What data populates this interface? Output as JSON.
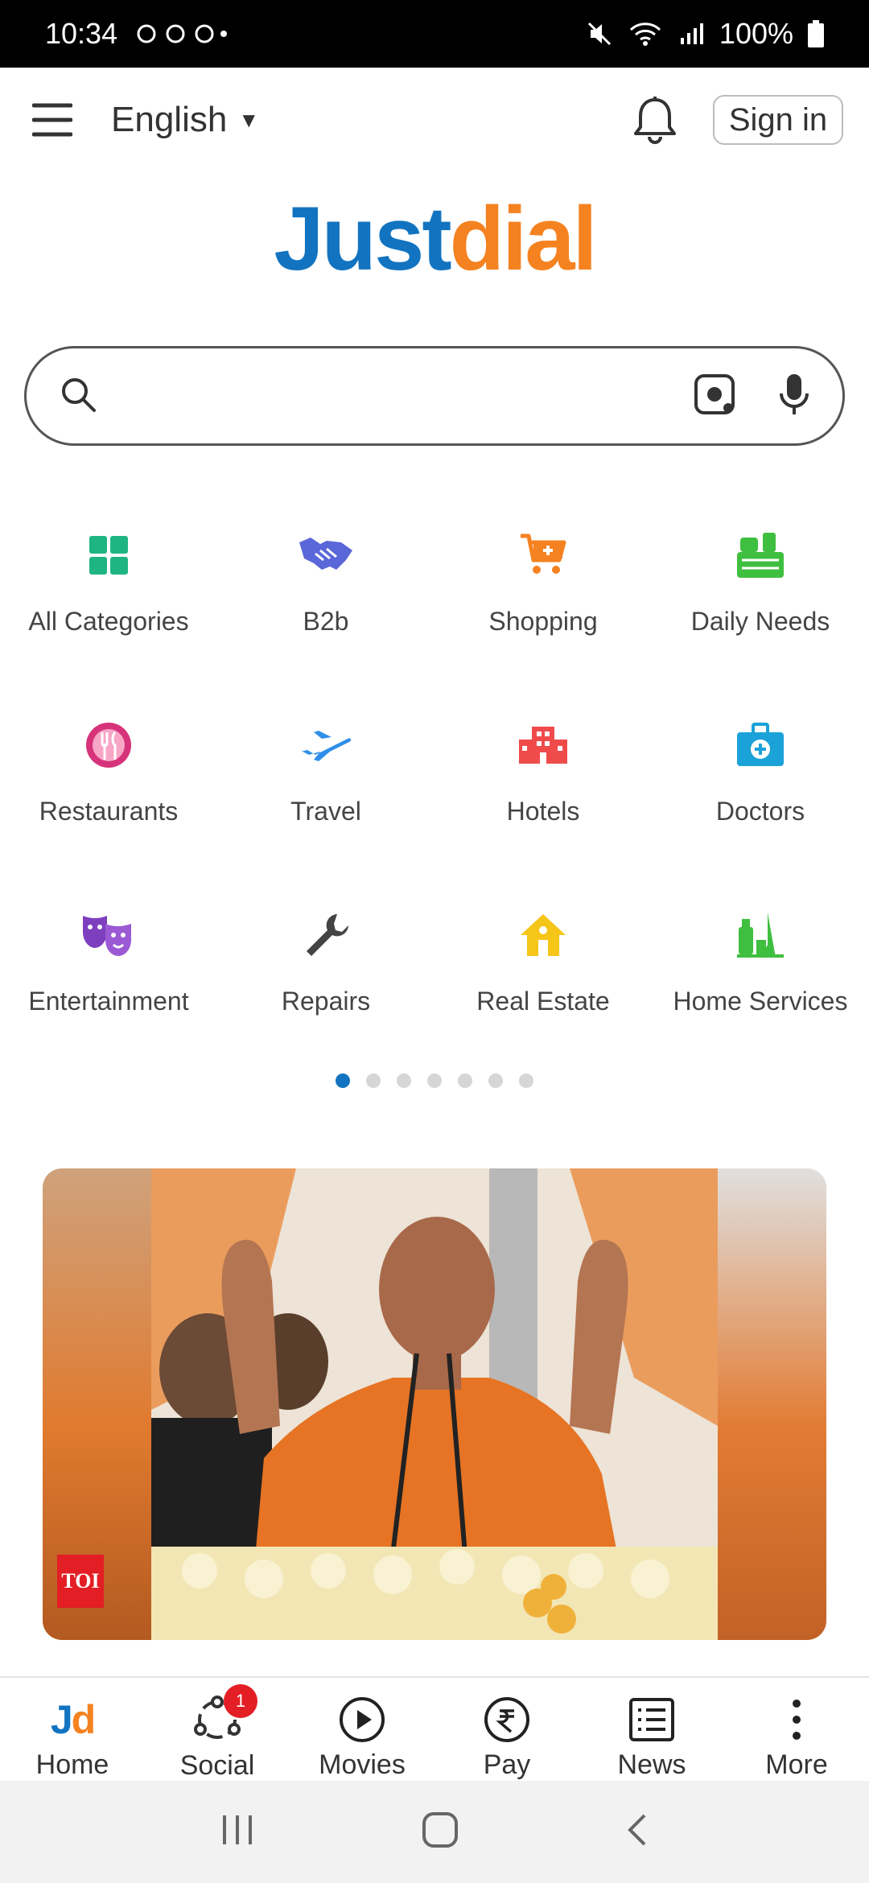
{
  "status_bar": {
    "time": "10:34",
    "battery": "100%"
  },
  "header": {
    "language": "English",
    "sign_in_label": "Sign in"
  },
  "logo": {
    "part1": "Just",
    "part2": "dial"
  },
  "search": {
    "placeholder": ""
  },
  "categories": [
    {
      "label": "All Categories",
      "icon": "grid-icon"
    },
    {
      "label": "B2b",
      "icon": "handshake-icon"
    },
    {
      "label": "Shopping",
      "icon": "cart-icon"
    },
    {
      "label": "Daily Needs",
      "icon": "groceries-icon"
    },
    {
      "label": "Restaurants",
      "icon": "cutlery-icon"
    },
    {
      "label": "Travel",
      "icon": "airplane-icon"
    },
    {
      "label": "Hotels",
      "icon": "building-icon"
    },
    {
      "label": "Doctors",
      "icon": "medical-kit-icon"
    },
    {
      "label": "Entertainment",
      "icon": "theater-masks-icon"
    },
    {
      "label": "Repairs",
      "icon": "wrench-icon"
    },
    {
      "label": "Real Estate",
      "icon": "house-icon"
    },
    {
      "label": "Home Services",
      "icon": "cleaning-icon"
    }
  ],
  "carousel": {
    "pages": 7,
    "active_index": 0
  },
  "banner": {
    "source_badge": "TOI"
  },
  "bottom_nav": [
    {
      "label": "Home",
      "icon": "jd-logo-icon"
    },
    {
      "label": "Social",
      "icon": "social-icon",
      "badge": "1"
    },
    {
      "label": "Movies",
      "icon": "play-icon"
    },
    {
      "label": "Pay",
      "icon": "rupee-icon"
    },
    {
      "label": "News",
      "icon": "news-icon"
    },
    {
      "label": "More",
      "icon": "more-vertical-icon"
    }
  ],
  "colors": {
    "brand_blue": "#1274c0",
    "brand_orange": "#f58220",
    "badge_red": "#e31e24"
  }
}
